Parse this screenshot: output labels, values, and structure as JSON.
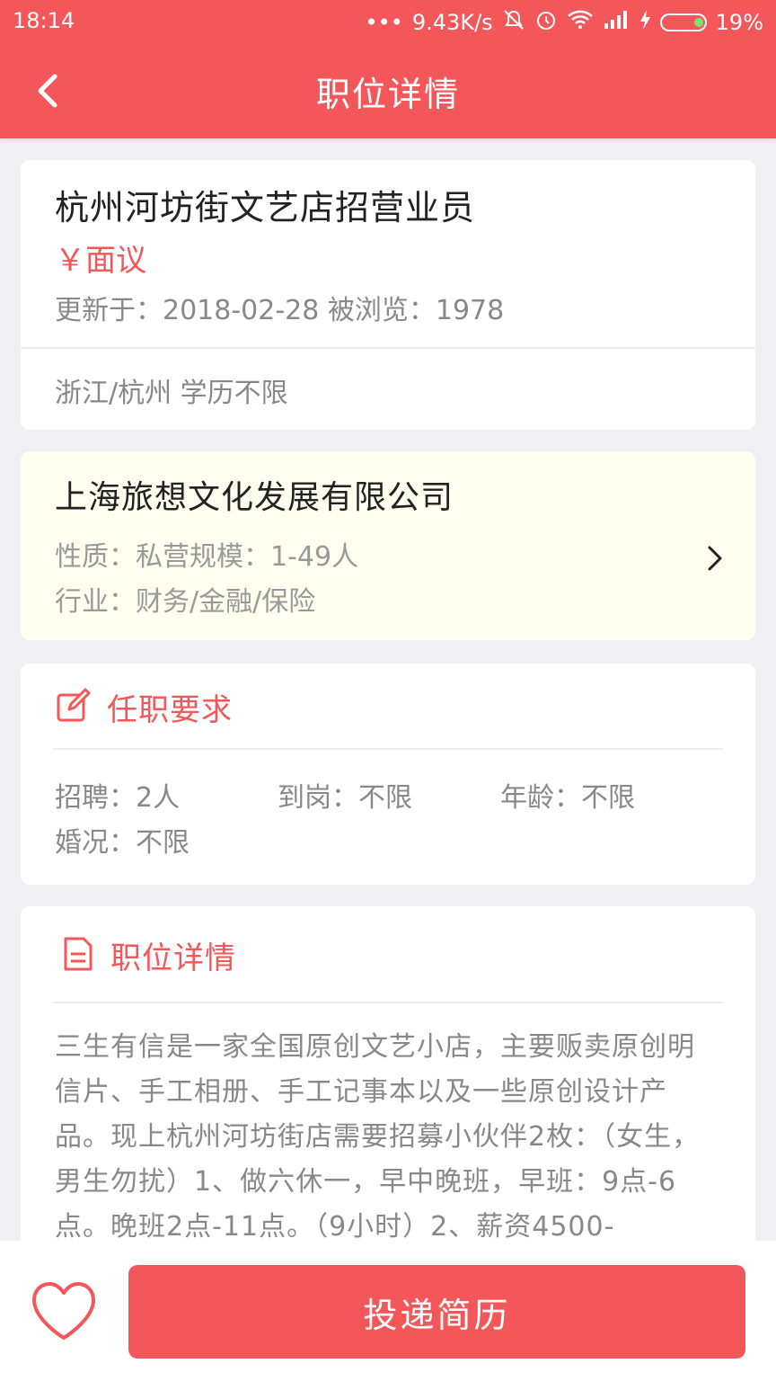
{
  "status_bar": {
    "time": "18:14",
    "dots": "•••",
    "net_speed": "9.43K/s",
    "battery": "19%"
  },
  "app_bar": {
    "title": "职位详情"
  },
  "job": {
    "title": "杭州河坊街文艺店招营业员",
    "salary": "￥面议",
    "meta": "更新于：2018-02-28 被浏览：1978",
    "tags": "浙江/杭州 学历不限"
  },
  "company": {
    "name": "上海旅想文化发展有限公司",
    "line1": "性质：私营规模：1-49人",
    "line2": "行业：财务/金融/保险"
  },
  "requirements": {
    "title": "任职要求",
    "items": [
      "招聘：2人",
      "到岗：不限",
      "年龄：不限",
      "婚况：不限"
    ]
  },
  "detail": {
    "title": "职位详情",
    "text": "三生有信是一家全国原创文艺小店，主要贩卖原创明信片、手工相册、手工记事本以及一些原创设计产品。现上杭州河坊街店需要招募小伙伴2枚：（女生，男生勿扰）1、做六休一，早中晚班，早班：9点-6点。晚班2点-11点。（9小时）2、薪资4500-"
  },
  "bottom": {
    "apply_label": "投递简历"
  },
  "colors": {
    "accent": "#f4575a",
    "company_bg": "#fffff0"
  }
}
